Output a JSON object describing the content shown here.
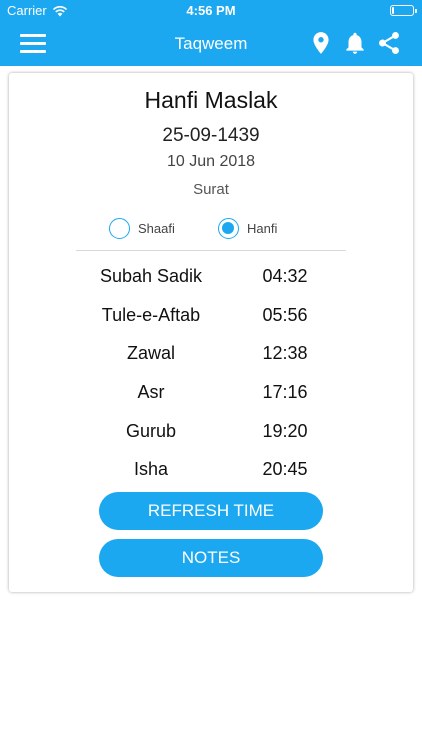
{
  "status": {
    "carrier": "Carrier",
    "time": "4:56 PM",
    "battery_fraction": 0.1
  },
  "nav": {
    "title": "Taqweem",
    "left_icon": "hamburger-menu-icon",
    "right_icons": [
      "map-pin-icon",
      "bell-icon",
      "share-icon"
    ]
  },
  "card": {
    "title": "Hanfi Maslak",
    "hijri_date": "25-09-1439",
    "gregorian_date": "10 Jun 2018",
    "city": "Surat",
    "madhab_options": [
      {
        "label": "Shaafi",
        "selected": false
      },
      {
        "label": "Hanfi",
        "selected": true
      }
    ],
    "prayer_times": [
      {
        "name": "Subah Sadik",
        "time": "04:32"
      },
      {
        "name": "Tule-e-Aftab",
        "time": "05:56"
      },
      {
        "name": "Zawal",
        "time": "12:38"
      },
      {
        "name": "Asr",
        "time": "17:16"
      },
      {
        "name": "Gurub",
        "time": "19:20"
      },
      {
        "name": "Isha",
        "time": "20:45"
      }
    ],
    "buttons": {
      "refresh": "REFRESH TIME",
      "notes": "NOTES"
    }
  },
  "colors": {
    "accent": "#1ba8f0"
  }
}
